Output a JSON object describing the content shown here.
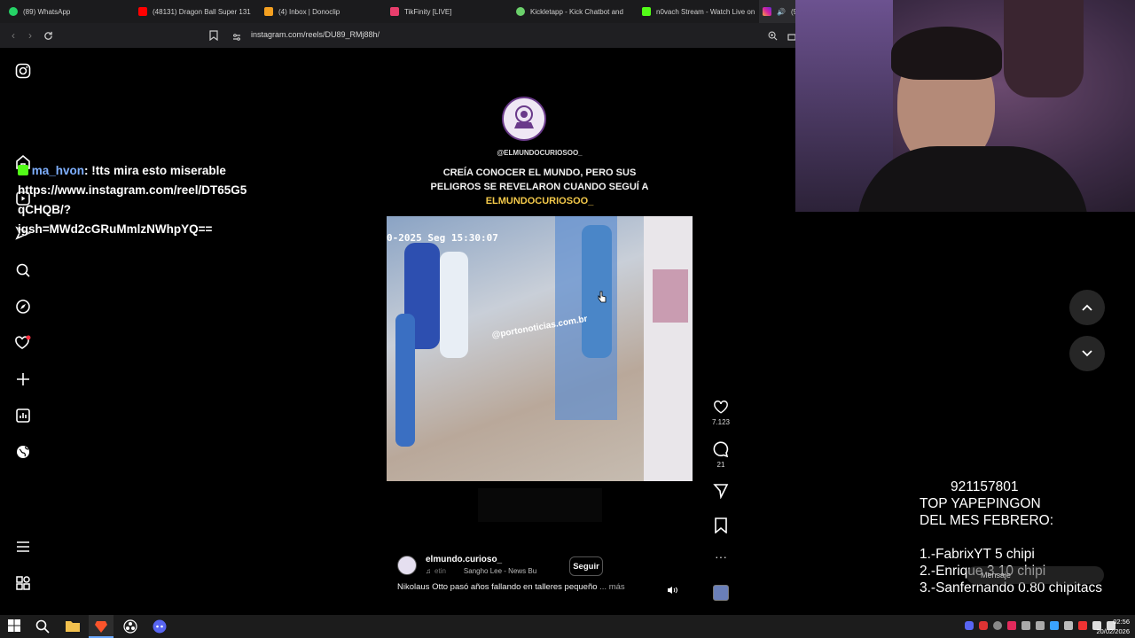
{
  "browser": {
    "tabs": [
      {
        "label": "(89) WhatsApp",
        "color": "#25d366"
      },
      {
        "label": "(48131) Dragon Ball Super 131",
        "color": "#ff0000"
      },
      {
        "label": "(4) Inbox | Donoclip",
        "color": "#f4a020"
      },
      {
        "label": "TikFinity [LIVE]",
        "color": "#e83e6c"
      },
      {
        "label": "Kickletapp - Kick Chatbot and",
        "color": "#6bd06b"
      },
      {
        "label": "n0vach Stream - Watch Live on",
        "color": "#53fc18"
      },
      {
        "label": "(9",
        "color": "#d6249f"
      }
    ],
    "url": "instagram.com/reels/DU89_RMj88h/"
  },
  "reel": {
    "handle_top": "@ELMUNDOCURIOSOO_",
    "caption_line1": "CREÍA CONOCER EL MUNDO, PERO SUS",
    "caption_line2": "PELIGROS SE REVELARON CUANDO SEGUÍ A",
    "caption_highlight": "ELMUNDOCURIOSOO_",
    "video_timestamp": "0-2025 Seg 15:30:07",
    "video_watermark": "@portonoticias.com.br",
    "author": "elmundo.curioso_",
    "follow_label": "Seguir",
    "audio_prefix": "etin",
    "audio_name": "Sangho Lee - News Bu",
    "description": "Nikolaus Otto pasó años fallando en talleres pequeño",
    "more_label": "... más",
    "likes": "7.123",
    "comments": "21"
  },
  "chat": {
    "user": "ma_hvon",
    "message": ": !tts mira esto miserable",
    "line2": "https://www.instagram.com/reel/DT65G5",
    "line3": "qCHQB/?",
    "line4": "igsh=MWd2cGRuMmlzNWhpYQ=="
  },
  "donate": {
    "number": "921157801",
    "title1": "TOP YAPEPINGON",
    "title2": "DEL MES FEBRERO:",
    "rank1": "1.-FabrixYT 5 chipi",
    "rank2": "2.-Enrique 3.10 chipi",
    "rank3": "3.-Sanfernando 0.80 chipitacs",
    "message_label": "Mensaje"
  },
  "taskbar": {
    "time": "02:56",
    "date": "20/02/2026"
  }
}
